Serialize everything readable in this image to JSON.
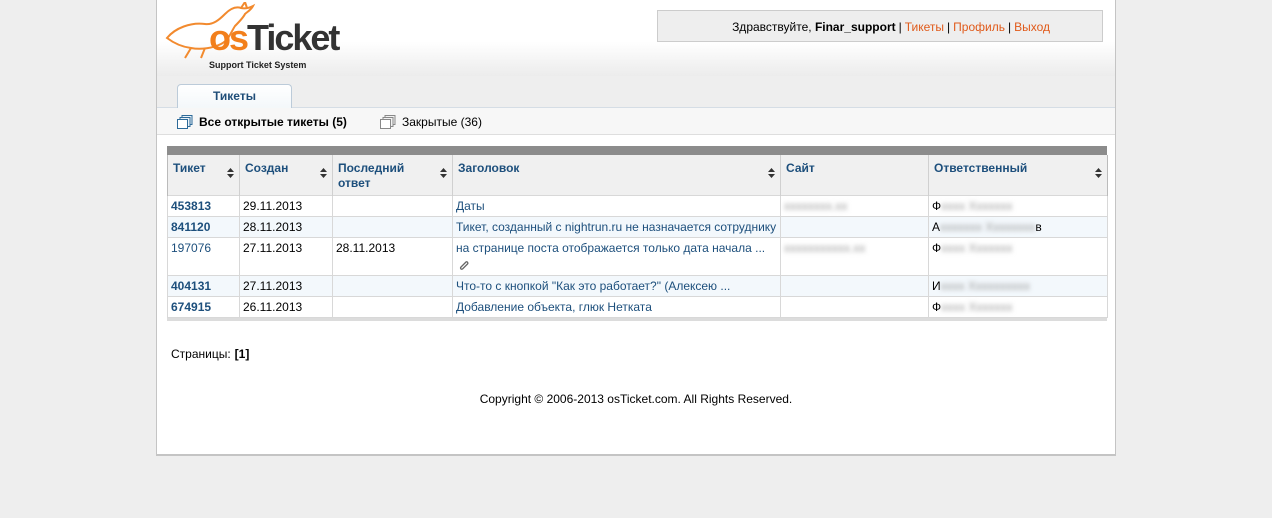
{
  "logo": {
    "wordmark_os": "os",
    "wordmark_ticket": "Ticket",
    "tagline": "Support Ticket System"
  },
  "userbar": {
    "greeting": "Здравствуйте,",
    "username": "Finar_support",
    "separator": "|",
    "tickets_link": "Тикеты",
    "profile_link": "Профиль",
    "logout_link": "Выход"
  },
  "nav": {
    "tickets_tab": "Тикеты"
  },
  "subnav": {
    "open_tickets": "Все открытые тикеты (5)",
    "closed_tickets": "Закрытые (36)"
  },
  "table": {
    "columns": {
      "ticket": "Тикет",
      "created": "Создан",
      "last_reply": "Последний ответ",
      "subject": "Заголовок",
      "site": "Сайт",
      "assignee": "Ответственный"
    },
    "rows": [
      {
        "id": "453813",
        "id_bold": true,
        "created": "29.11.2013",
        "last_reply": "",
        "subject": "Даты",
        "attachment": false,
        "site": "xxxxxxxx.xx",
        "assignee_initial": "Ф",
        "assignee_rest": "xxxx Xxxxxxx",
        "assignee_tail": ""
      },
      {
        "id": "841120",
        "id_bold": true,
        "created": "28.11.2013",
        "last_reply": "",
        "subject": "Тикет, созданный с nightrun.ru не назначается сотруднику",
        "attachment": false,
        "site": "",
        "assignee_initial": "А",
        "assignee_rest": "xxxxxxx Xxxxxxxx",
        "assignee_tail": "в"
      },
      {
        "id": "197076",
        "id_bold": false,
        "created": "27.11.2013",
        "last_reply": "28.11.2013",
        "subject": "на странице поста отображается только дата начала ...",
        "attachment": true,
        "site": "xxxxxxxxxxx.xx",
        "assignee_initial": "Ф",
        "assignee_rest": "xxxx Xxxxxxx",
        "assignee_tail": ""
      },
      {
        "id": "404131",
        "id_bold": true,
        "created": "27.11.2013",
        "last_reply": "",
        "subject": "Что-то с кнопкой \"Как это работает?\" (Алексею ...",
        "attachment": false,
        "site": "",
        "assignee_initial": "И",
        "assignee_rest": "xxxx Xxxxxxxxxx",
        "assignee_tail": ""
      },
      {
        "id": "674915",
        "id_bold": true,
        "created": "26.11.2013",
        "last_reply": "",
        "subject": "Добавление объекта, глюк Неткатa",
        "attachment": false,
        "site": "",
        "assignee_initial": "Ф",
        "assignee_rest": "xxxx Xxxxxxx",
        "assignee_tail": ""
      }
    ]
  },
  "pagination": {
    "label": "Страницы:",
    "current": "[1]"
  },
  "footer": {
    "copyright": "Copyright © 2006-2013 osTicket.com.  All Rights Reserved."
  },
  "colors": {
    "link_orange": "#e05a1a",
    "link_blue": "#1d4f7c",
    "brand_orange": "#f27f1b"
  }
}
